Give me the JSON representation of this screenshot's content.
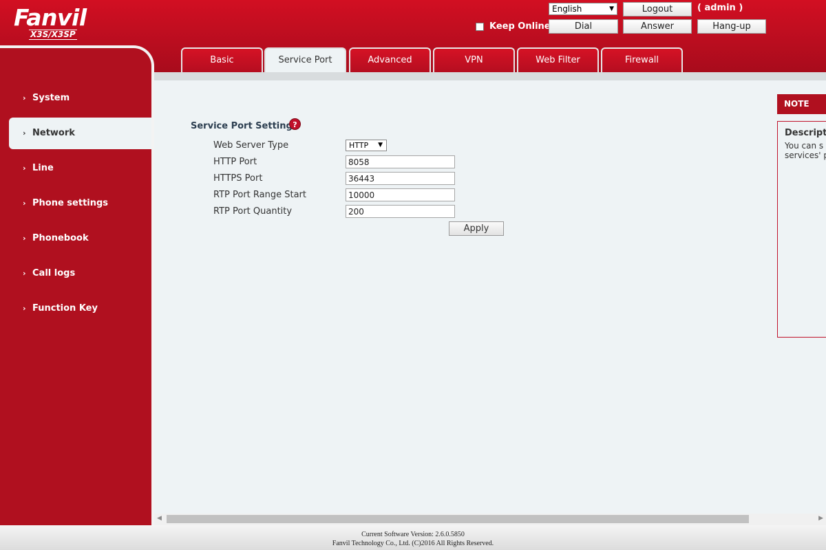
{
  "header": {
    "brand": "Fanvil",
    "model": "X3S/X3SP",
    "language": "English",
    "logout_label": "Logout",
    "user_label": "( admin )",
    "keep_online_label": "Keep Online",
    "dial_label": "Dial",
    "answer_label": "Answer",
    "hangup_label": "Hang-up"
  },
  "tabs": [
    {
      "label": "Basic",
      "active": false
    },
    {
      "label": "Service Port",
      "active": true
    },
    {
      "label": "Advanced",
      "active": false
    },
    {
      "label": "VPN",
      "active": false
    },
    {
      "label": "Web Filter",
      "active": false
    },
    {
      "label": "Firewall",
      "active": false
    }
  ],
  "sidebar": {
    "items": [
      {
        "label": "System",
        "active": false
      },
      {
        "label": "Network",
        "active": true
      },
      {
        "label": "Line",
        "active": false
      },
      {
        "label": "Phone settings",
        "active": false
      },
      {
        "label": "Phonebook",
        "active": false
      },
      {
        "label": "Call logs",
        "active": false
      },
      {
        "label": "Function Key",
        "active": false
      }
    ]
  },
  "main": {
    "section_title": "Service Port Settings",
    "help_icon": "help-icon",
    "fields": {
      "web_server_type": {
        "label": "Web Server Type",
        "value": "HTTP"
      },
      "http_port": {
        "label": "HTTP Port",
        "value": "8058"
      },
      "https_port": {
        "label": "HTTPS Port",
        "value": "36443"
      },
      "rtp_start": {
        "label": "RTP Port Range Start",
        "value": "10000"
      },
      "rtp_quantity": {
        "label": "RTP Port Quantity",
        "value": "200"
      }
    },
    "apply_label": "Apply"
  },
  "note": {
    "header": "NOTE",
    "title": "Descripti",
    "line1": "You can s",
    "line2": "services' p"
  },
  "footer": {
    "version": "Current Software Version: 2.6.0.5850",
    "copyright": "Fanvil Technology Co., Ltd. (C)2016 All Rights Reserved."
  },
  "colors": {
    "brand_red": "#b0101f",
    "content_bg": "#eef3f5"
  }
}
